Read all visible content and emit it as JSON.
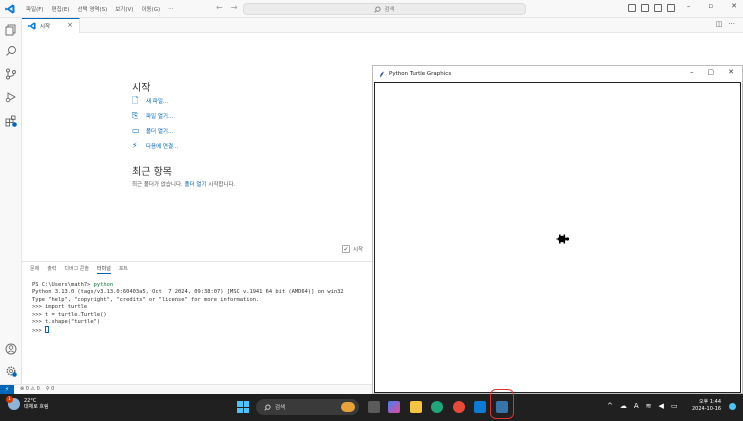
{
  "menus": [
    "파일(F)",
    "편집(E)",
    "선택 영역(S)",
    "보기(V)",
    "이동(G)",
    "···"
  ],
  "search": {
    "label": "검색"
  },
  "tab": {
    "label": "시작",
    "close": "×"
  },
  "welcome": {
    "title": "시작",
    "links": [
      "새 파일...",
      "파일 열기...",
      "폴더 열기...",
      "다음에 연결..."
    ],
    "recent_title": "최근 항목",
    "recent_text_before": "최근 폴더가 없습니다.",
    "recent_link": "폴더 열기",
    "recent_text_after": "시작합니다.",
    "show_on_startup": "시작"
  },
  "panel": {
    "tabs": [
      "문제",
      "출력",
      "디버그 콘솔",
      "터미널",
      "포트"
    ],
    "active_tab": "터미널",
    "terminal": {
      "prompt_line": "PS C:\\Users\\math7> ",
      "prompt_cmd": "python",
      "lines": [
        "Python 3.13.0 (tags/v3.13.0:60403a5, Oct  7 2024, 09:38:07) [MSC v.1941 64 bit (AMD64)] on win32",
        "Type \"help\", \"copyright\", \"credits\" or \"license\" for more information."
      ],
      "repl": [
        {
          "prompt": ">>> ",
          "code": "import turtle"
        },
        {
          "prompt": ">>> ",
          "code": "t = turtle.Turtle()"
        },
        {
          "prompt": ">>> ",
          "code": "t.shape(\"turtle\")"
        }
      ],
      "last_prompt": ">>> "
    }
  },
  "statusbar": {
    "remote": "⚡",
    "problems": "⊗ 0 ⚠ 0",
    "ports": "⚲ 0"
  },
  "turtle_window": {
    "title": "Python Turtle Graphics"
  },
  "taskbar": {
    "weather_temp": "22°C",
    "weather_desc": "대체로 흐림",
    "weather_badge": "1",
    "search": "검색",
    "time": "오후 1:44",
    "date": "2024-10-16"
  },
  "colors": {
    "accent": "#0066b8",
    "taskbar": "#202020",
    "highlight": "#e03030"
  }
}
